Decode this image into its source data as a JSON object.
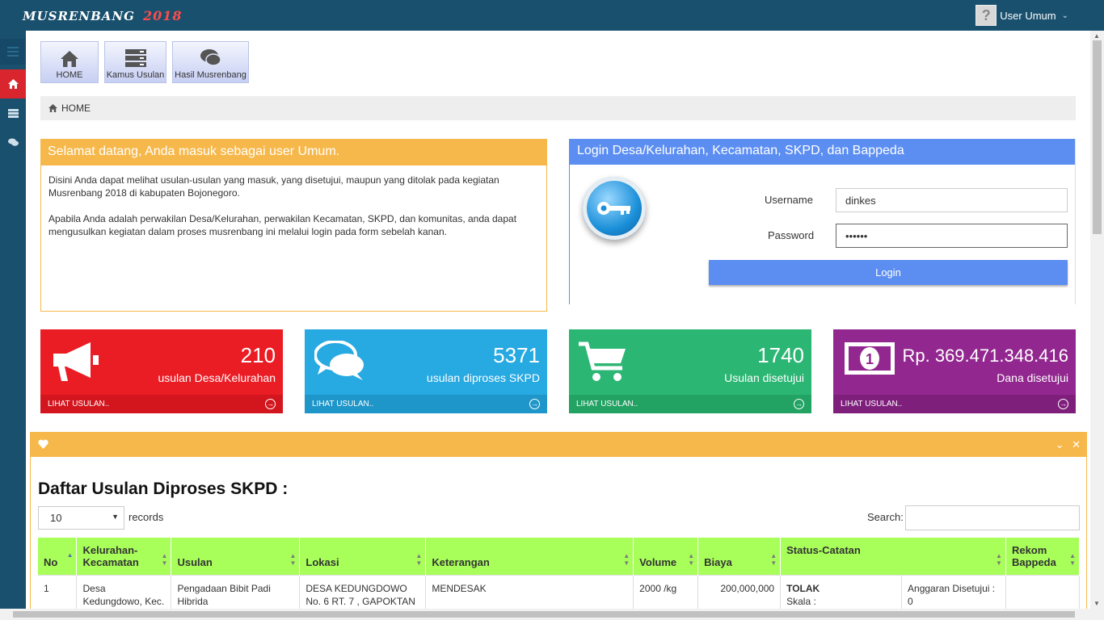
{
  "app": {
    "brand": "MUSRENBANG",
    "year": "2018"
  },
  "user": {
    "name": "User Umum"
  },
  "shortcuts": [
    {
      "label": "HOME",
      "icon": "home-icon"
    },
    {
      "label": "Kamus Usulan",
      "icon": "server-icon"
    },
    {
      "label": "Hasil Musrenbang",
      "icon": "comments-icon"
    }
  ],
  "breadcrumb": {
    "label": "HOME"
  },
  "welcome": {
    "title": "Selamat datang, Anda masuk sebagai user Umum.",
    "para1": "Disini Anda dapat melihat usulan-usulan yang masuk, yang disetujui, maupun yang ditolak pada kegiatan Musrenbang 2018 di kabupaten Bojonegoro.",
    "para2": "Apabila Anda adalah perwakilan Desa/Kelurahan, perwakilan Kecamatan, SKPD, dan komunitas, anda dapat mengusulkan kegiatan dalam proses musrenbang ini melalui login pada form sebelah kanan."
  },
  "login": {
    "title": "Login Desa/Kelurahan, Kecamatan, SKPD, dan Bappeda",
    "username_label": "Username",
    "username_value": "dinkes",
    "password_label": "Password",
    "password_value": "••••••",
    "button": "Login"
  },
  "tiles": [
    {
      "value": "210",
      "caption": "usulan Desa/Kelurahan",
      "link": "LIHAT USULAN..",
      "icon": "bullhorn-icon",
      "color": "#ea1c24",
      "foot": "#d3161e"
    },
    {
      "value": "5371",
      "caption": "usulan diproses SKPD",
      "link": "LIHAT USULAN..",
      "icon": "comments-icon",
      "color": "#27a9e1",
      "foot": "#1e96c9"
    },
    {
      "value": "1740",
      "caption": "Usulan disetujui",
      "link": "LIHAT USULAN..",
      "icon": "cart-icon",
      "color": "#2bb673",
      "foot": "#22a263"
    },
    {
      "value": "Rp. 369.471.348.416",
      "caption": "Dana disetujui",
      "link": "LIHAT USULAN..",
      "icon": "money-icon",
      "color": "#92278f",
      "foot": "#7f1f7c"
    }
  ],
  "table": {
    "title": "Daftar Usulan Diproses SKPD :",
    "length_value": "10",
    "length_label": "records",
    "search_label": "Search:",
    "headers": {
      "no": "No",
      "kel": "Kelurahan-Kecamatan",
      "usulan": "Usulan",
      "lokasi": "Lokasi",
      "ket": "Keterangan",
      "volume": "Volume",
      "biaya": "Biaya",
      "status": "Status-Catatan",
      "rekom": "Rekom Bappeda"
    },
    "row1": {
      "no": "1",
      "kel": "Desa Kedungdowo, Kec.",
      "usulan": "Pengadaan Bibit Padi Hibrida",
      "lokasi": "DESA KEDUNGDOWO No. 6 RT. 7 , GAPOKTAN",
      "ket": "MENDESAK",
      "volume": "2000 /kg",
      "biaya": "200,000,000",
      "status": "TOLAK",
      "skala": "Skala :",
      "anggaran": "Anggaran Disetujui : 0",
      "rekom": ""
    }
  },
  "colors": {
    "navbar": "#19506e",
    "accent_orange": "#f7b84b",
    "accent_blue": "#5c8ef2",
    "table_header": "#a8ff5a"
  }
}
